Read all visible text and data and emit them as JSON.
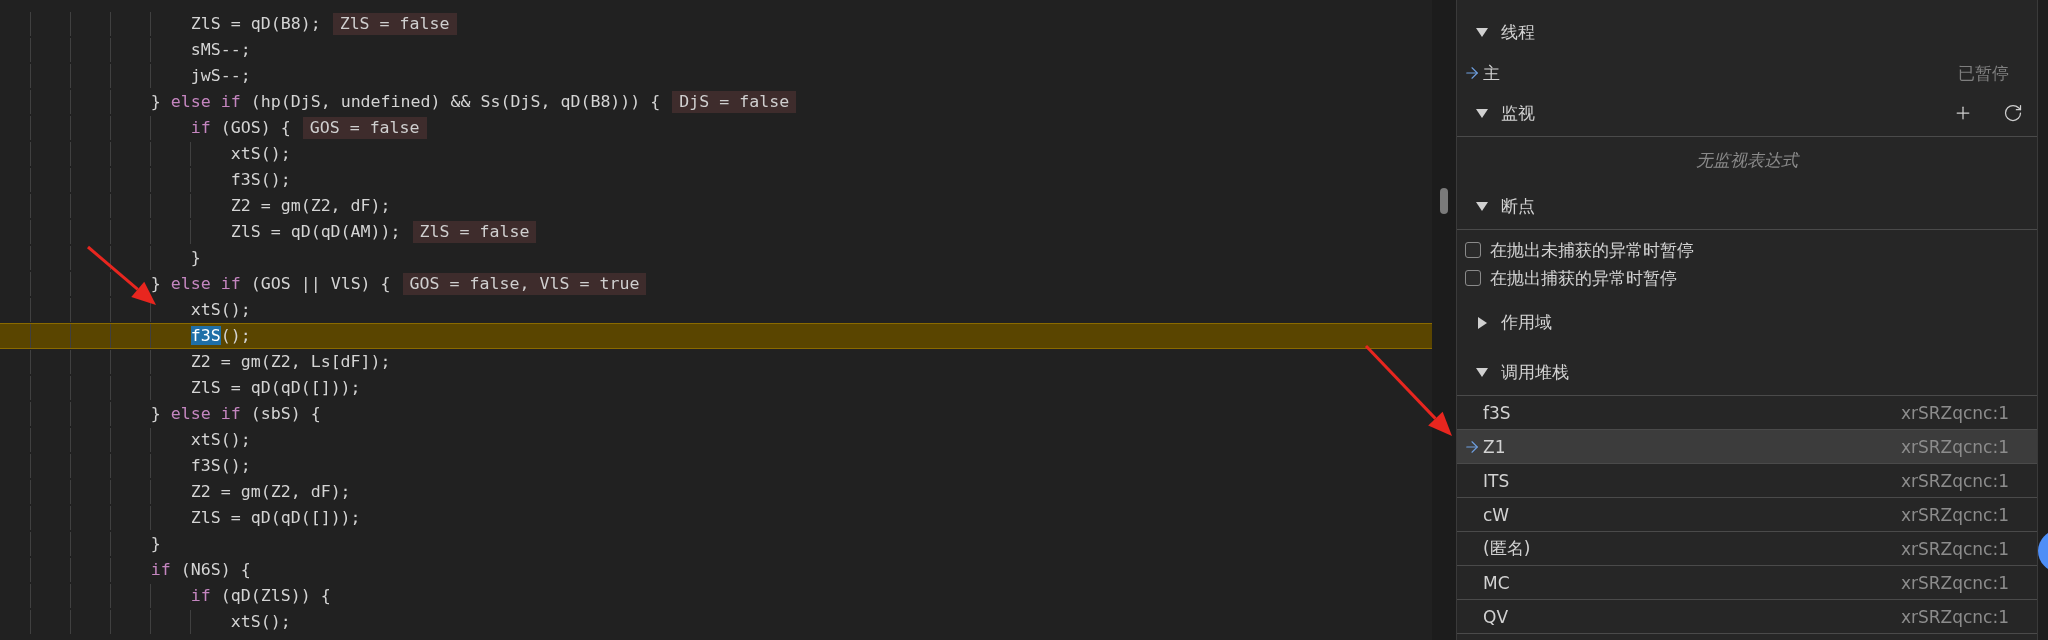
{
  "editor": {
    "lines": [
      {
        "tokens": [
          {
            "kind": "plain",
            "text": "                    ZlS = qD(B8);"
          }
        ],
        "inline_value": "ZlS = false"
      },
      {
        "tokens": [
          {
            "kind": "plain",
            "text": "                    sMS--;"
          }
        ]
      },
      {
        "tokens": [
          {
            "kind": "plain",
            "text": "                    jwS--;"
          }
        ]
      },
      {
        "tokens": [
          {
            "kind": "plain",
            "text": "                } "
          },
          {
            "kind": "keyword",
            "text": "else if"
          },
          {
            "kind": "plain",
            "text": " (hp(DjS, undefined) && Ss(DjS, qD(B8))) {"
          }
        ],
        "inline_value": "DjS = false"
      },
      {
        "tokens": [
          {
            "kind": "keyword",
            "text": "                    if"
          },
          {
            "kind": "plain",
            "text": " (GOS) {"
          }
        ],
        "inline_value": "GOS = false"
      },
      {
        "tokens": [
          {
            "kind": "plain",
            "text": "                        xtS();"
          }
        ]
      },
      {
        "tokens": [
          {
            "kind": "plain",
            "text": "                        f3S();"
          }
        ]
      },
      {
        "tokens": [
          {
            "kind": "plain",
            "text": "                        Z2 = gm(Z2, dF);"
          }
        ]
      },
      {
        "tokens": [
          {
            "kind": "plain",
            "text": "                        ZlS = qD(qD(AM));"
          }
        ],
        "inline_value": "ZlS = false"
      },
      {
        "tokens": [
          {
            "kind": "plain",
            "text": "                    }"
          }
        ]
      },
      {
        "tokens": [
          {
            "kind": "plain",
            "text": "                } "
          },
          {
            "kind": "keyword",
            "text": "else if"
          },
          {
            "kind": "plain",
            "text": " (GOS || VlS) {"
          }
        ],
        "inline_value": "GOS = false, VlS = true"
      },
      {
        "tokens": [
          {
            "kind": "plain",
            "text": "                    xtS();"
          }
        ]
      },
      {
        "current": true,
        "tokens": [
          {
            "kind": "selection",
            "text": "                    f3S"
          },
          {
            "kind": "plain",
            "text": "();"
          }
        ]
      },
      {
        "tokens": [
          {
            "kind": "plain",
            "text": "                    Z2 = gm(Z2, Ls[dF]);"
          }
        ]
      },
      {
        "tokens": [
          {
            "kind": "plain",
            "text": "                    ZlS = qD(qD([]));"
          }
        ]
      },
      {
        "tokens": [
          {
            "kind": "plain",
            "text": "                } "
          },
          {
            "kind": "keyword",
            "text": "else if"
          },
          {
            "kind": "plain",
            "text": " (sbS) {"
          }
        ]
      },
      {
        "tokens": [
          {
            "kind": "plain",
            "text": "                    xtS();"
          }
        ]
      },
      {
        "tokens": [
          {
            "kind": "plain",
            "text": "                    f3S();"
          }
        ]
      },
      {
        "tokens": [
          {
            "kind": "plain",
            "text": "                    Z2 = gm(Z2, dF);"
          }
        ]
      },
      {
        "tokens": [
          {
            "kind": "plain",
            "text": "                    ZlS = qD(qD([]));"
          }
        ]
      },
      {
        "tokens": [
          {
            "kind": "plain",
            "text": "                }"
          }
        ]
      },
      {
        "tokens": [
          {
            "kind": "keyword",
            "text": "                if"
          },
          {
            "kind": "plain",
            "text": " (N6S) {"
          }
        ]
      },
      {
        "tokens": [
          {
            "kind": "keyword",
            "text": "                    if"
          },
          {
            "kind": "plain",
            "text": " (qD(ZlS)) {"
          }
        ]
      },
      {
        "tokens": [
          {
            "kind": "plain",
            "text": "                        xtS();"
          }
        ]
      }
    ]
  },
  "debugger": {
    "sections": [
      {
        "kind": "threads",
        "title": "线程",
        "expanded": true,
        "threads": [
          {
            "name": "主",
            "status": "已暂停",
            "selected": true
          }
        ]
      },
      {
        "kind": "watch",
        "title": "监视",
        "expanded": true,
        "empty_text": "无监视表达式"
      },
      {
        "kind": "breakpoints",
        "title": "断点",
        "expanded": true,
        "options": [
          {
            "label": "在抛出未捕获的异常时暂停",
            "checked": false
          },
          {
            "label": "在抛出捕获的异常时暂停",
            "checked": false
          }
        ]
      },
      {
        "kind": "scope",
        "title": "作用域",
        "expanded": false
      },
      {
        "kind": "call_stack",
        "title": "调用堆栈",
        "expanded": true,
        "frames": [
          {
            "name": "f3S",
            "location": "xrSRZqcnc:1",
            "selected": false
          },
          {
            "name": "Z1",
            "location": "xrSRZqcnc:1",
            "selected": true
          },
          {
            "name": "ITS",
            "location": "xrSRZqcnc:1",
            "selected": false
          },
          {
            "name": "cW",
            "location": "xrSRZqcnc:1",
            "selected": false
          },
          {
            "name": "(匿名)",
            "location": "xrSRZqcnc:1",
            "selected": false
          },
          {
            "name": "MC",
            "location": "xrSRZqcnc:1",
            "selected": false
          },
          {
            "name": "QV",
            "location": "xrSRZqcnc:1",
            "selected": false
          }
        ]
      }
    ]
  }
}
